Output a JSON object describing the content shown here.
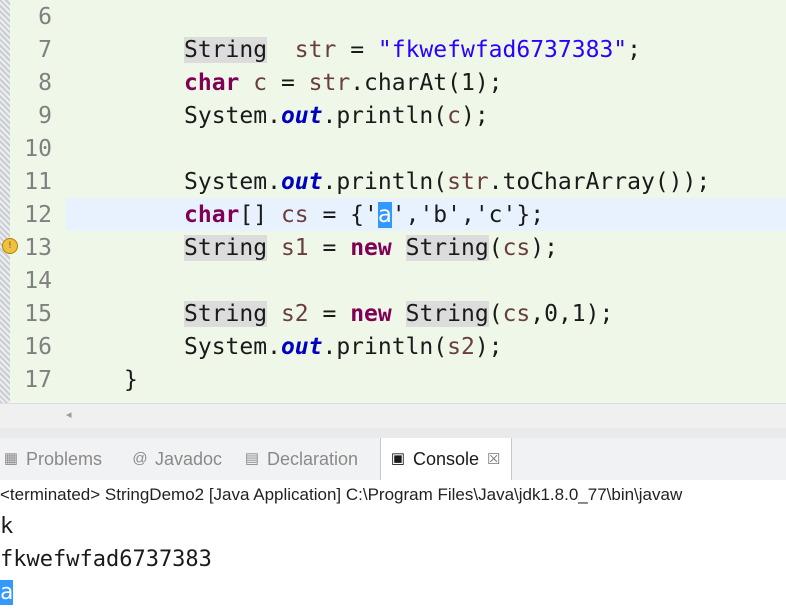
{
  "editor": {
    "lines": [
      {
        "no": "6",
        "code": []
      },
      {
        "no": "7",
        "code": [
          [
            "type",
            "String"
          ],
          [
            "",
            "  "
          ],
          [
            "var",
            "str"
          ],
          [
            "",
            " = "
          ],
          [
            "str",
            "\"fkwefwfad6737383\""
          ],
          [
            "",
            ";"
          ]
        ]
      },
      {
        "no": "8",
        "code": [
          [
            "kw",
            "char"
          ],
          [
            "",
            " "
          ],
          [
            "var",
            "c"
          ],
          [
            "",
            " = "
          ],
          [
            "var",
            "str"
          ],
          [
            "",
            ".charAt(1);"
          ]
        ]
      },
      {
        "no": "9",
        "code": [
          [
            "",
            "System."
          ],
          [
            "fld",
            "out"
          ],
          [
            "",
            ".println("
          ],
          [
            "var",
            "c"
          ],
          [
            "",
            ");"
          ]
        ]
      },
      {
        "no": "10",
        "code": []
      },
      {
        "no": "11",
        "code": [
          [
            "",
            "System."
          ],
          [
            "fld",
            "out"
          ],
          [
            "",
            ".println("
          ],
          [
            "var",
            "str"
          ],
          [
            "",
            ".toCharArray());"
          ]
        ]
      },
      {
        "no": "12",
        "code": [
          [
            "kw",
            "char"
          ],
          [
            "",
            "[] "
          ],
          [
            "var",
            "cs"
          ],
          [
            "",
            " = {'"
          ],
          [
            "sel",
            "a"
          ],
          [
            "",
            "','b','c'};"
          ]
        ]
      },
      {
        "no": "13",
        "code": [
          [
            "type",
            "String"
          ],
          [
            "",
            " "
          ],
          [
            "var",
            "s1"
          ],
          [
            "",
            " = "
          ],
          [
            "kw",
            "new"
          ],
          [
            "",
            " "
          ],
          [
            "type",
            "String"
          ],
          [
            "",
            "("
          ],
          [
            "var",
            "cs"
          ],
          [
            "",
            ");"
          ]
        ]
      },
      {
        "no": "14",
        "code": []
      },
      {
        "no": "15",
        "code": [
          [
            "type",
            "String"
          ],
          [
            "",
            " "
          ],
          [
            "var",
            "s2"
          ],
          [
            "",
            " = "
          ],
          [
            "kw",
            "new"
          ],
          [
            "",
            " "
          ],
          [
            "type",
            "String"
          ],
          [
            "",
            "("
          ],
          [
            "var",
            "cs"
          ],
          [
            "",
            ",0,1);"
          ]
        ]
      },
      {
        "no": "16",
        "code": [
          [
            "",
            "System."
          ],
          [
            "fld",
            "out"
          ],
          [
            "",
            ".println("
          ],
          [
            "var",
            "s2"
          ],
          [
            "",
            ");"
          ]
        ]
      },
      {
        "no": "17",
        "code": [
          [
            "",
            "}"
          ]
        ]
      }
    ]
  },
  "tabs": {
    "problems": {
      "label": "Problems",
      "icon": "problems-icon"
    },
    "javadoc": {
      "label": "Javadoc",
      "icon": "at-icon"
    },
    "declaration": {
      "label": "Declaration",
      "icon": "declaration-icon"
    },
    "console": {
      "label": "Console",
      "icon": "console-icon",
      "close": "☒"
    }
  },
  "console": {
    "header": "<terminated> StringDemo2 [Java Application] C:\\Program Files\\Java\\jdk1.8.0_77\\bin\\javaw",
    "output": [
      "k",
      "fkwefwfad6737383",
      "a"
    ]
  },
  "colors": {
    "editor_bg": "#eef7e8",
    "keyword": "#7f0055",
    "string": "#2a00ff",
    "field": "#0000c0",
    "selection": "#3399ff"
  }
}
